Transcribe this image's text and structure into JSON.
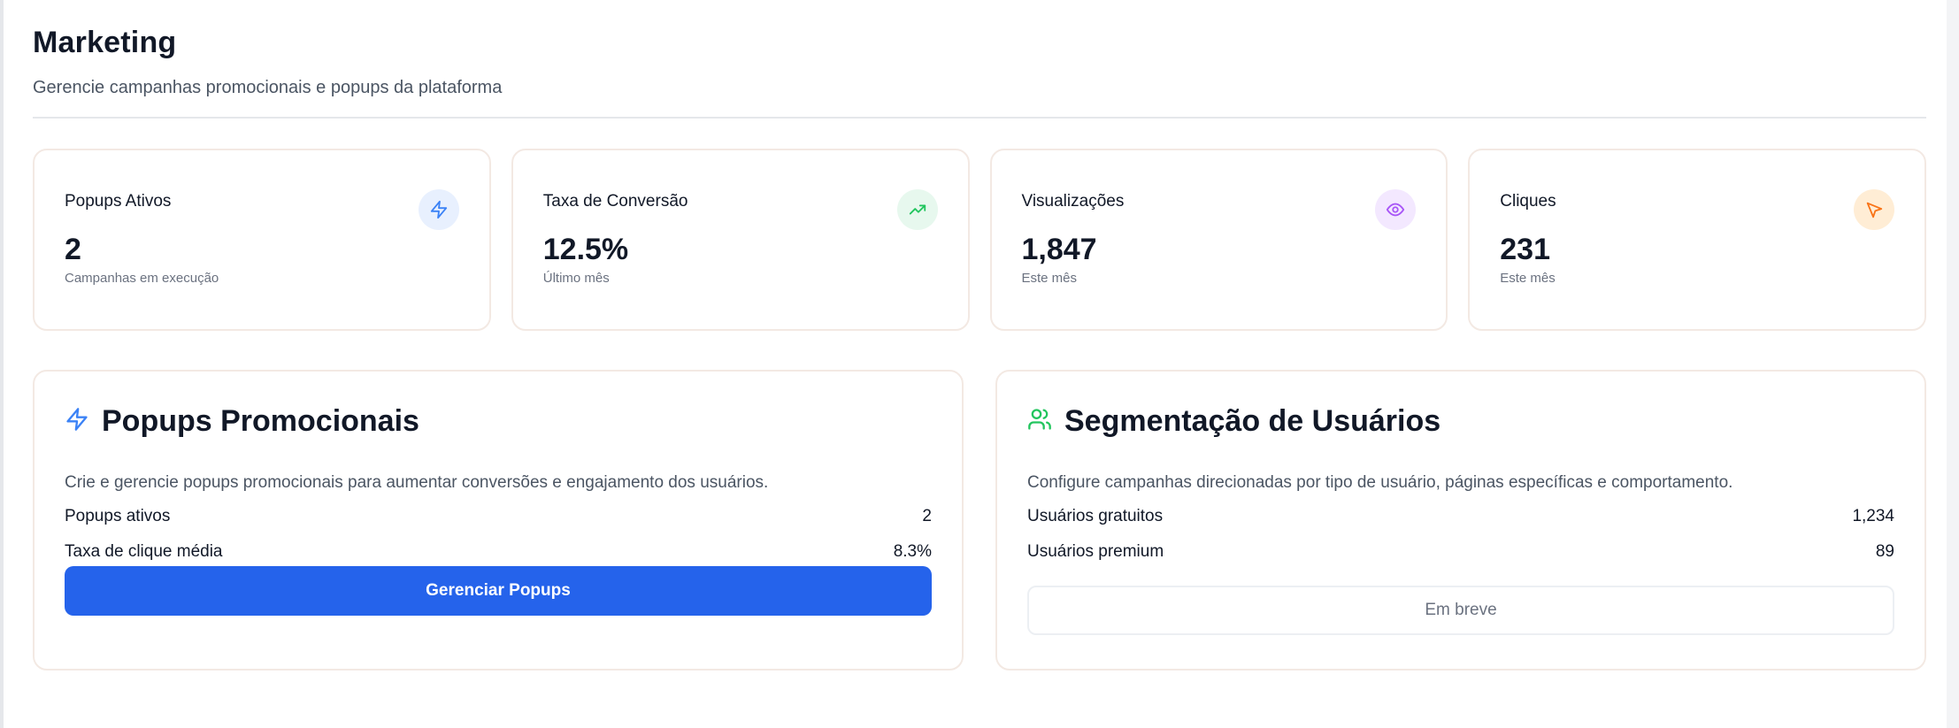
{
  "header": {
    "title": "Marketing",
    "subtitle": "Gerencie campanhas promocionais e popups da plataforma"
  },
  "stats": [
    {
      "label": "Popups Ativos",
      "value": "2",
      "note": "Campanhas em execução",
      "icon": "zap-icon",
      "icon_color": "#3b82f6",
      "icon_bg": "#e8f0fe"
    },
    {
      "label": "Taxa de Conversão",
      "value": "12.5%",
      "note": "Último mês",
      "icon": "trending-up-icon",
      "icon_color": "#22c55e",
      "icon_bg": "#e7f8ee"
    },
    {
      "label": "Visualizações",
      "value": "1,847",
      "note": "Este mês",
      "icon": "eye-icon",
      "icon_color": "#a855f7",
      "icon_bg": "#f3e8ff"
    },
    {
      "label": "Cliques",
      "value": "231",
      "note": "Este mês",
      "icon": "cursor-icon",
      "icon_color": "#f97316",
      "icon_bg": "#ffedd5"
    }
  ],
  "popups_panel": {
    "title": "Popups Promocionais",
    "icon": "zap-icon",
    "icon_color": "#3b82f6",
    "description": "Crie e gerencie popups promocionais para aumentar conversões e engajamento dos usuários.",
    "rows": [
      {
        "label": "Popups ativos",
        "value": "2"
      },
      {
        "label": "Taxa de clique média",
        "value": "8.3%"
      }
    ],
    "button_label": "Gerenciar Popups",
    "button_color": "#2563eb"
  },
  "segmentation_panel": {
    "title": "Segmentação de Usuários",
    "icon": "users-icon",
    "icon_color": "#22c55e",
    "description": "Configure campanhas direcionadas por tipo de usuário, páginas específicas e comportamento.",
    "rows": [
      {
        "label": "Usuários gratuitos",
        "value": "1,234"
      },
      {
        "label": "Usuários premium",
        "value": "89"
      }
    ],
    "button_label": "Em breve"
  }
}
